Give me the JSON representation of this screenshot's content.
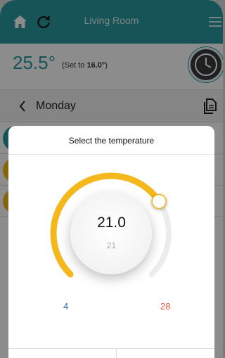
{
  "header": {
    "title": "Living Room"
  },
  "status": {
    "current_temp": "25.5°",
    "set_to_prefix": "(Set to ",
    "set_to_value": "16.0°",
    "set_to_suffix": ")"
  },
  "schedule": {
    "day": "Monday"
  },
  "dialog": {
    "title": "Select the temperature",
    "value": "21.0",
    "sub_value": "21",
    "min_label": "4",
    "max_label": "28",
    "min": 4,
    "max": 28,
    "current": 21.0
  },
  "colors": {
    "header": "#2a9a9e",
    "accent_temp": "#2a9a9e",
    "arc": "#f5b81c",
    "min": "#2f6fb0",
    "max": "#e25b3b",
    "dot_teal": "#2a9a9e",
    "dot_yellow": "#f5b81c"
  },
  "icons": {
    "home": "home-icon",
    "sync": "sync-icon",
    "menu": "menu-icon",
    "clock": "clock-icon",
    "back": "chevron-left-icon",
    "copy": "copy-icon"
  }
}
